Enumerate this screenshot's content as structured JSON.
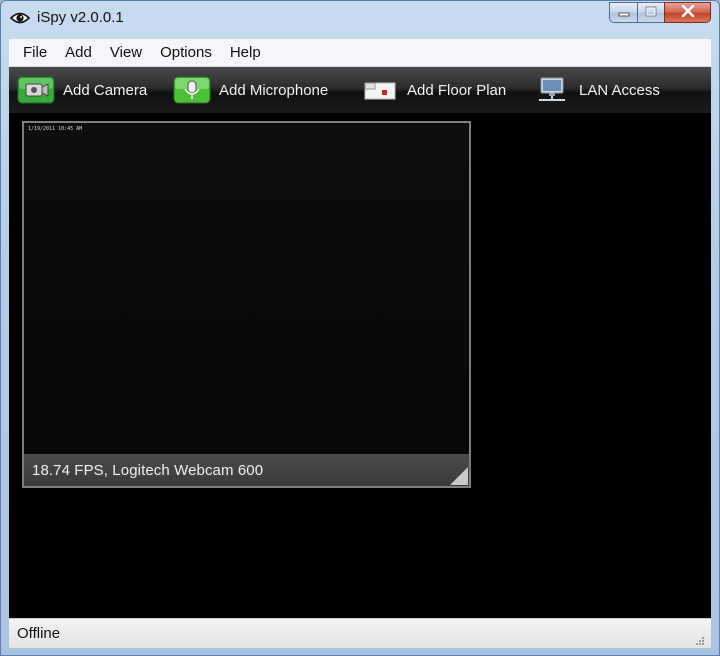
{
  "window": {
    "title": "iSpy v2.0.0.1",
    "controls": [
      "minimize-icon",
      "maximize-icon",
      "close-icon"
    ]
  },
  "menu": {
    "items": [
      {
        "label": "File"
      },
      {
        "label": "Add"
      },
      {
        "label": "View"
      },
      {
        "label": "Options"
      },
      {
        "label": "Help"
      }
    ]
  },
  "toolbar": {
    "buttons": [
      {
        "label": "Add Camera",
        "icon": "camera-icon",
        "color": "#3aa83a"
      },
      {
        "label": "Add Microphone",
        "icon": "microphone-icon",
        "color": "#4fbf3a"
      },
      {
        "label": "Add Floor Plan",
        "icon": "floor-plan-icon",
        "color": "#d32020"
      },
      {
        "label": "LAN Access",
        "icon": "lan-icon",
        "color": "#9aa6b4"
      }
    ]
  },
  "camera": {
    "timestamp": "1/19/2011 10:45 AM",
    "caption": "18.74 FPS, Logitech Webcam 600"
  },
  "status": {
    "text": "Offline"
  }
}
